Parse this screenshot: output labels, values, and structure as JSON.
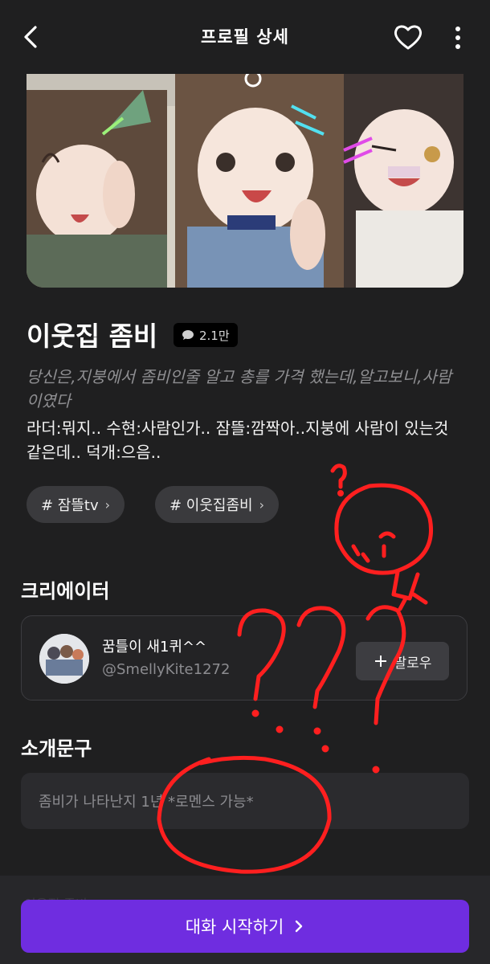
{
  "header": {
    "title": "프로필 상세",
    "back_icon": "chevron-left-icon",
    "like_icon": "heart-outline-icon",
    "more_icon": "more-vertical-icon"
  },
  "character": {
    "name": "이웃집 좀비",
    "chat_count": "2.1만",
    "tagline": "당신은,지붕에서 좀비인줄 알고 총를 가격 했는데,알고보니,사람이였다",
    "description": " 라더:뭐지.. 수현:사람인가.. 잠뜰:깜짝아..지붕에 사람이 있는것 같은데.. 덕개:으음..",
    "tags": [
      {
        "label": "# 잠뜰tv"
      },
      {
        "label": "# 이웃집좀비"
      }
    ]
  },
  "creator_section": {
    "title": "크리에이터",
    "name": "꿈틀이 새1퀴^^",
    "handle": "@SmellyKite1272",
    "follow_label": "팔로우"
  },
  "intro_section": {
    "title": "소개문구",
    "text": "좀비가 나타난지 1년 *로멘스 가능*"
  },
  "cta": {
    "label": "대화 시작하기",
    "faded_text": "이웃집 좀비"
  },
  "colors": {
    "background": "#1f1f20",
    "accent": "#6f2de0",
    "scribble": "#ff1f1f"
  }
}
